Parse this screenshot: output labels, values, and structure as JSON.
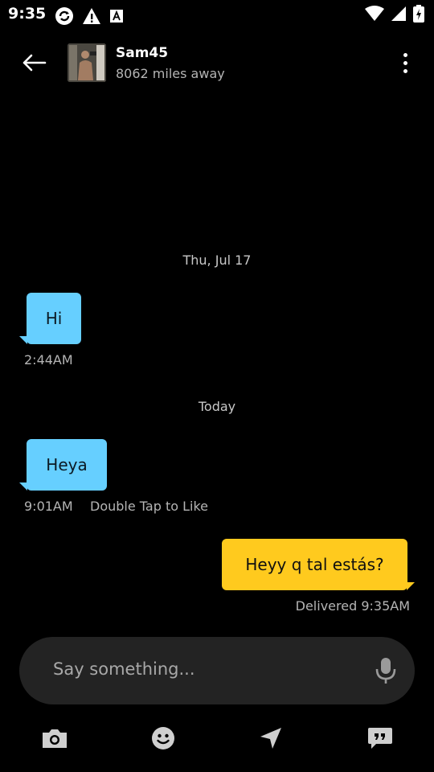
{
  "status_bar": {
    "time": "9:35"
  },
  "header": {
    "username": "Sam45",
    "distance": "8062 miles away"
  },
  "messages": {
    "date_1": "Thu, Jul 17",
    "msg_1": {
      "text": "Hi",
      "time": "2:44AM"
    },
    "date_2": "Today",
    "msg_2": {
      "text": "Heya",
      "time": "9:01AM",
      "hint": "Double Tap to Like"
    },
    "msg_3": {
      "text": "Heyy q tal estás?",
      "status": "Delivered 9:35AM"
    }
  },
  "composer": {
    "placeholder": "Say something..."
  },
  "toolbar": {
    "icons": [
      "camera-icon",
      "emoji-icon",
      "location-icon",
      "quote-icon"
    ]
  },
  "colors": {
    "incoming_bubble": "#66cfff",
    "outgoing_bubble": "#ffca1e",
    "background": "#000000",
    "input_background": "#232323"
  }
}
